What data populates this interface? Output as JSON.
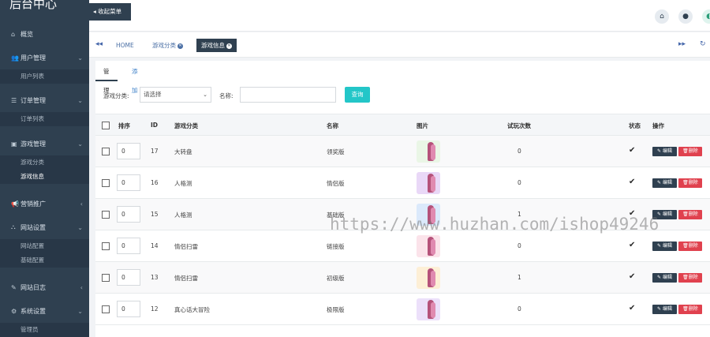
{
  "sidebar": {
    "brand": "后台中心",
    "menu": [
      {
        "label": "概览",
        "icon": "home-icon",
        "glyph": "⌂",
        "arrow": ""
      },
      {
        "label": "用户管理",
        "icon": "users-icon",
        "glyph": "👥",
        "arrow": "⌄"
      },
      {
        "label": "订单管理",
        "icon": "list-icon",
        "glyph": "☰",
        "arrow": "⌄"
      },
      {
        "label": "游戏管理",
        "icon": "gamepad-icon",
        "glyph": "▣",
        "arrow": "⌄"
      },
      {
        "label": "营销推广",
        "icon": "megaphone-icon",
        "glyph": "📢",
        "arrow": "‹"
      },
      {
        "label": "网站设置",
        "icon": "sitemap-icon",
        "glyph": "⛬",
        "arrow": "⌄"
      },
      {
        "label": "网站日志",
        "icon": "edit-icon",
        "glyph": "✎",
        "arrow": "‹"
      },
      {
        "label": "系统设置",
        "icon": "gear-icon",
        "glyph": "⚙",
        "arrow": "⌄"
      }
    ],
    "sub": {
      "users": [
        "用户列表"
      ],
      "orders": [
        "订单列表"
      ],
      "games": [
        "游戏分类",
        "游戏信息"
      ],
      "site": [
        "网站配置",
        "基础配置"
      ],
      "system": [
        "管理员"
      ]
    }
  },
  "topbar": {
    "collapse_label": "◂ 收起菜单",
    "icons": [
      "home-icon",
      "user-icon"
    ]
  },
  "tabs": {
    "items": [
      {
        "label": "HOME"
      },
      {
        "label": "游戏分类"
      },
      {
        "label": "游戏信息"
      }
    ],
    "active_index": 2
  },
  "subtabs": [
    "管理",
    "添加"
  ],
  "filter": {
    "category_label": "游戏分类:",
    "category_value": "请选择",
    "name_label": "名称:",
    "name_value": "",
    "search_button": "查询"
  },
  "table": {
    "headers": [
      "排序",
      "ID",
      "游戏分类",
      "名称",
      "图片",
      "试玩次数",
      "状态",
      "操作"
    ],
    "edit_label": "编辑",
    "delete_label": "删除",
    "rows": [
      {
        "sort": "0",
        "id": "17",
        "category": "大转盘",
        "name": "领奖版",
        "trials": "0",
        "thumb_bg": "#eaf6e6"
      },
      {
        "sort": "0",
        "id": "16",
        "category": "人格测",
        "name": "情侣版",
        "trials": "0",
        "thumb_bg": "#e9d8f7"
      },
      {
        "sort": "0",
        "id": "15",
        "category": "人格测",
        "name": "基础版",
        "trials": "1",
        "thumb_bg": "#dbe9fb"
      },
      {
        "sort": "0",
        "id": "14",
        "category": "情侣扫雷",
        "name": "链接版",
        "trials": "0",
        "thumb_bg": "#fbe3ea"
      },
      {
        "sort": "0",
        "id": "13",
        "category": "情侣扫雷",
        "name": "初级版",
        "trials": "1",
        "thumb_bg": "#fdefd6"
      },
      {
        "sort": "0",
        "id": "12",
        "category": "真心话大冒险",
        "name": "极限版",
        "trials": "0",
        "thumb_bg": "#ece0fa"
      }
    ]
  },
  "watermark": "https://www.huzhan.com/ishop49246",
  "colors": {
    "sidebar": "#2f4050",
    "accent": "#23c6c8",
    "danger": "#e0414e"
  }
}
